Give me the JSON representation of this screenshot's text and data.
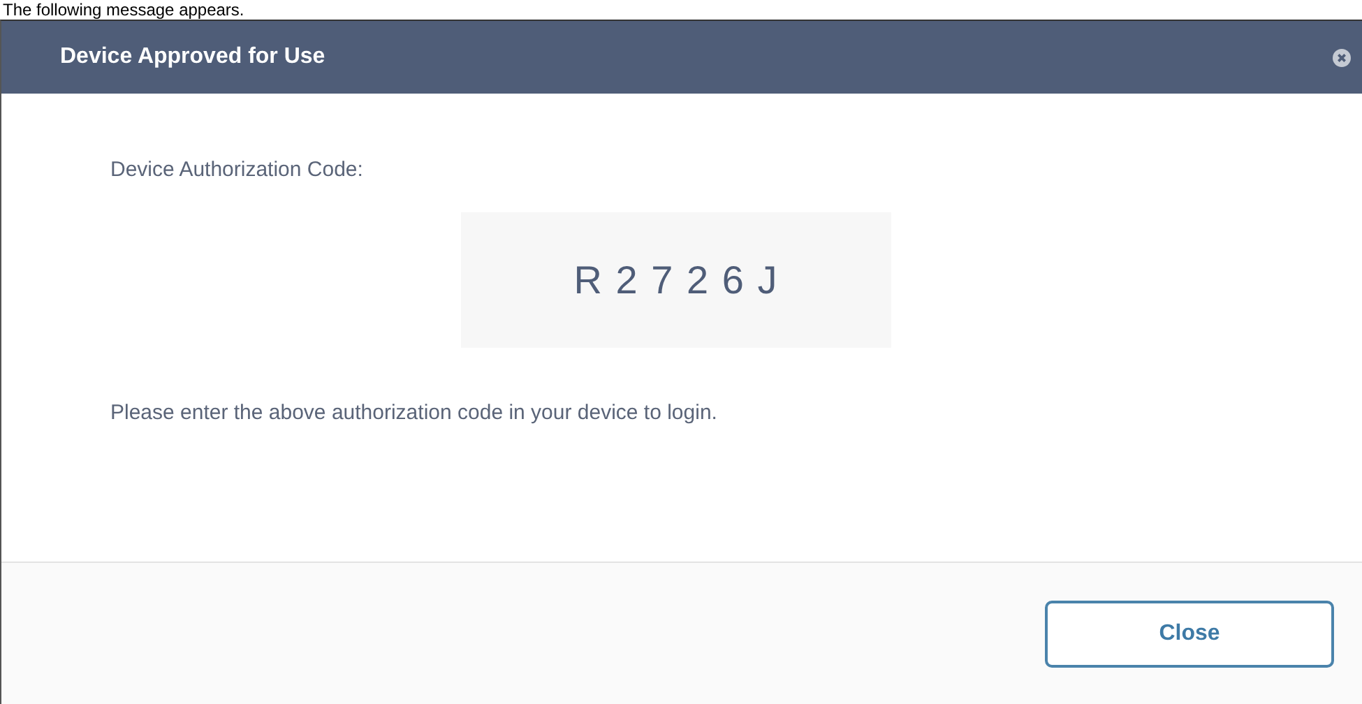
{
  "caption": "The following message appears.",
  "dialog": {
    "title": "Device Approved for Use",
    "label": "Device Authorization Code:",
    "code": "R 2 7 2 6 J",
    "message": "Please enter the above authorization code in your device to login.",
    "buttons": [
      "Close"
    ]
  }
}
